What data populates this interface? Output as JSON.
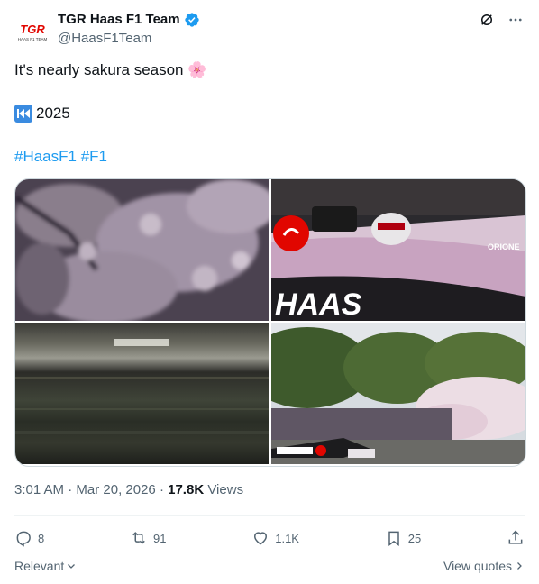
{
  "author": {
    "display_name": "TGR Haas F1 Team",
    "handle": "@HaasF1Team",
    "avatar_text": "TGR",
    "avatar_subtext": "HAAS F1 TEAM",
    "verified": true
  },
  "tweet": {
    "line1": "It's nearly sakura season",
    "line1_emoji": "🌸",
    "line2_emoji": "⏮",
    "line2": "2025",
    "hashtags": [
      "#HaasF1",
      "#F1"
    ]
  },
  "images": [
    {
      "name": "cherry-blossom-closeup"
    },
    {
      "name": "haas-car-pink-livery"
    },
    {
      "name": "motion-blur-track"
    },
    {
      "name": "car-trees-cherry-blossom"
    }
  ],
  "meta": {
    "time": "3:01 AM",
    "separator": "·",
    "date": "Mar 20, 2026",
    "views_count": "17.8K",
    "views_label": "Views"
  },
  "actions": {
    "replies": "8",
    "retweets": "91",
    "likes": "1.1K",
    "bookmarks": "25"
  },
  "footer": {
    "sort_label": "Relevant",
    "view_quotes_label": "View quotes"
  },
  "colors": {
    "accent": "#1d9bf0",
    "secondary_text": "#536471",
    "brand_red": "#e10600"
  }
}
